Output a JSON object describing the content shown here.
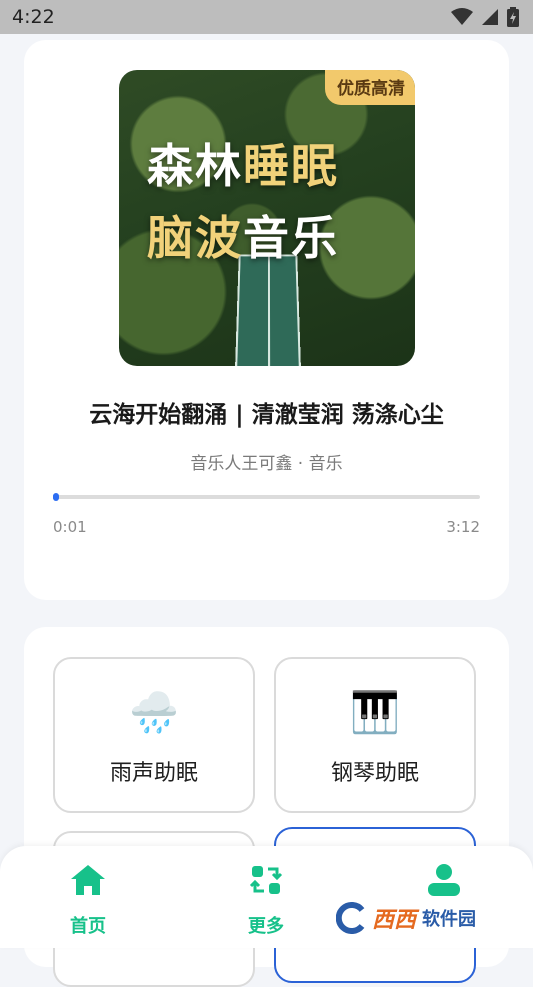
{
  "status_bar": {
    "time": "4:22"
  },
  "player": {
    "cover": {
      "badge": "优质高清",
      "line1_white": "森林",
      "line1_gold": "睡眠",
      "line2_gold": "脑波",
      "line2_white": "音乐"
    },
    "title": "云海开始翻涌 | 清澈莹润 荡涤心尘",
    "subtitle": "音乐人王可鑫 · 音乐",
    "progress": {
      "current": "0:01",
      "total": "3:12",
      "fraction": 0.005
    }
  },
  "scenes": [
    {
      "icon": "🌧️",
      "label": "雨声助眠"
    },
    {
      "icon": "🎹",
      "label": "钢琴助眠"
    }
  ],
  "bottom_nav": {
    "home": "首页",
    "more": "更多"
  },
  "watermark": {
    "logo_text": "西西",
    "text": "软件园"
  },
  "colors": {
    "accent": "#17c18a",
    "progress": "#2c6df2",
    "badge": "#f2c96c"
  }
}
